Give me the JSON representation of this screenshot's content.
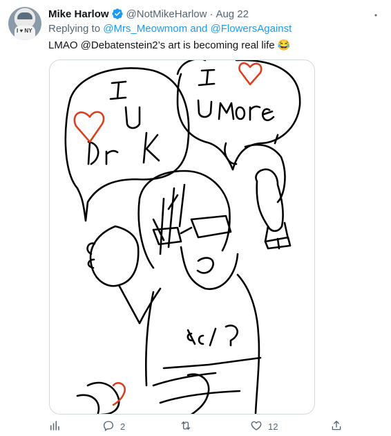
{
  "tweet": {
    "author_name": "Mike Harlow",
    "handle": "@NotMikeHarlow",
    "separator": "·",
    "date": "Aug 22",
    "reply_prefix": "Replying to ",
    "reply_mentions": "@Mrs_Meowmom and @FlowersAgainst",
    "text": "LMAO @Debatenstein2’s art is becoming real life 😂",
    "avatar_text": "I ♥ NY",
    "more_icon": "more-horizontal-icon"
  },
  "drawing": {
    "lettering": [
      "I",
      "U",
      "Dr K",
      "I",
      "U More",
      "5%?"
    ],
    "stroke_color": "#000000",
    "heart_color": "#d9401f"
  },
  "actions": {
    "analytics_icon": "analytics-icon",
    "reply_count": "2",
    "retweet_count": "",
    "like_count": "12",
    "share_icon": "share-icon",
    "icon_color": "#536471"
  },
  "colors": {
    "link": "#1d9bf0",
    "verified": "#1d9bf0",
    "secondary_text": "#536471"
  }
}
